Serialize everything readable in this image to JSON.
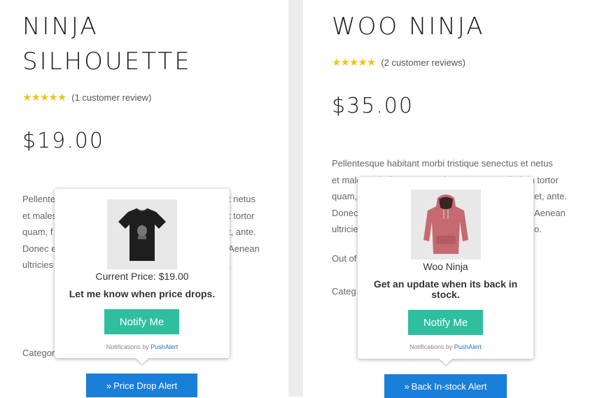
{
  "products": [
    {
      "title_line1": "NINJA",
      "title_line2": "SILHOUETTE",
      "stars": 5,
      "review_text": "(1 customer review)",
      "price": "$19.00",
      "desc_start": [
        "Pellente",
        "et males",
        "quam, f",
        "Donec e",
        "ultricies"
      ],
      "desc_end": [
        "t netus",
        "t tortor",
        "t, ante.",
        "Aenean",
        "."
      ],
      "category_fragment": "Categor",
      "popup": {
        "image_name": "black-tshirt",
        "line1": "Current Price: $19.00",
        "line2": "Let me know when price drops.",
        "button": "Notify Me",
        "powered_prefix": "Notifications by",
        "powered_brand": "PushAlert"
      },
      "cta_label": "Price Drop Alert",
      "cta_icon": "double-chevron-right"
    },
    {
      "title": "WOO NINJA",
      "stars": 5,
      "review_text": "(2 customer reviews)",
      "price": "$35.00",
      "desc_full": [
        "Pellentesque habitant morbi tristique senectus et netus",
        "et malesuada fames ac turpis egestas. Vestibulum tortor"
      ],
      "desc_start": [
        "quam,",
        "Donec",
        "ultricie"
      ],
      "desc_end": [
        "et, ante.",
        "Aenean",
        "o."
      ],
      "out_of_fragment": "Out of",
      "category_fragment": "Categ",
      "popup": {
        "image_name": "pink-hoodie",
        "line1": "Woo Ninja",
        "line2": "Get an update when its back in stock.",
        "button": "Notify Me",
        "powered_prefix": "Notifications by",
        "powered_brand": "PushAlert"
      },
      "cta_label": "Back In-stock Alert",
      "cta_icon": "double-chevron-right"
    }
  ],
  "colors": {
    "star": "#f4c21a",
    "notify_button": "#2fbf9e",
    "cta_button": "#1a7fd8",
    "brand_link": "#2b6fc2"
  }
}
